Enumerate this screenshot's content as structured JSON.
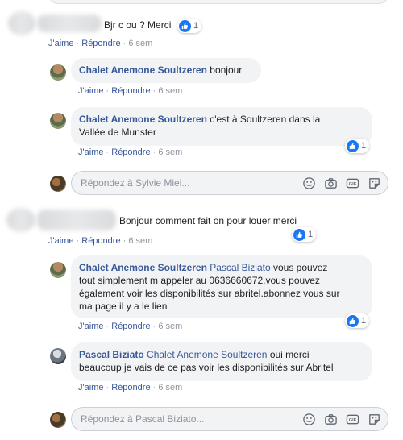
{
  "thread": {
    "comment1": {
      "text": "Bjr c ou ? Merci",
      "like_count": "1",
      "actions": {
        "like": "J'aime",
        "sep": "·",
        "reply": "Répondre",
        "time": "6 sem"
      }
    },
    "reply1": {
      "author": "Chalet Anemone Soultzeren",
      "text": "bonjour",
      "actions": {
        "like": "J'aime",
        "sep": "·",
        "reply": "Répondre",
        "time": "6 sem"
      }
    },
    "reply2": {
      "author": "Chalet Anemone Soultzeren",
      "text_line1": "c'est à Soultzeren dans la",
      "text_line2": "Vallée de Munster",
      "like_count": "1",
      "actions": {
        "like": "J'aime",
        "sep": "·",
        "reply": "Répondre",
        "time": "6 sem"
      }
    },
    "reply_box1": {
      "placeholder": "Répondez à Sylvie Miel..."
    },
    "comment2": {
      "text": "Bonjour comment fait on pour louer merci",
      "like_count": "1",
      "actions": {
        "like": "J'aime",
        "sep": "·",
        "reply": "Répondre",
        "time": "6 sem"
      }
    },
    "reply3": {
      "author": "Chalet Anemone Soultzeren",
      "mention": "Pascal Biziato",
      "text_line1": "vous pouvez",
      "text_line2": "tout simplement m appeler au 0636660672.vous pouvez",
      "text_line3": "également voir les disponibilités sur abritel.abonnez vous sur",
      "text_line4": "ma page il y a le lien",
      "like_count": "1",
      "actions": {
        "like": "J'aime",
        "sep": "·",
        "reply": "Répondre",
        "time": "6 sem"
      }
    },
    "reply4": {
      "author": "Pascal Biziato",
      "mention": "Chalet Anemone Soultzeren",
      "text_line1": "oui merci",
      "text_line2": "beaucoup je vais de ce pas voir les disponibilités sur Abritel",
      "actions": {
        "like": "J'aime",
        "sep": "·",
        "reply": "Répondre",
        "time": "6 sem"
      }
    },
    "reply_box2": {
      "placeholder": "Répondez à Pascal Biziato..."
    }
  },
  "icons": {
    "like": "like-thumb-icon",
    "emoji": "emoji-icon",
    "camera": "camera-icon",
    "gif": "gif-icon",
    "sticker": "sticker-icon"
  },
  "colors": {
    "link": "#385898",
    "like_blue": "#1877f2",
    "bubble": "#f2f3f5",
    "meta": "#90949c"
  }
}
